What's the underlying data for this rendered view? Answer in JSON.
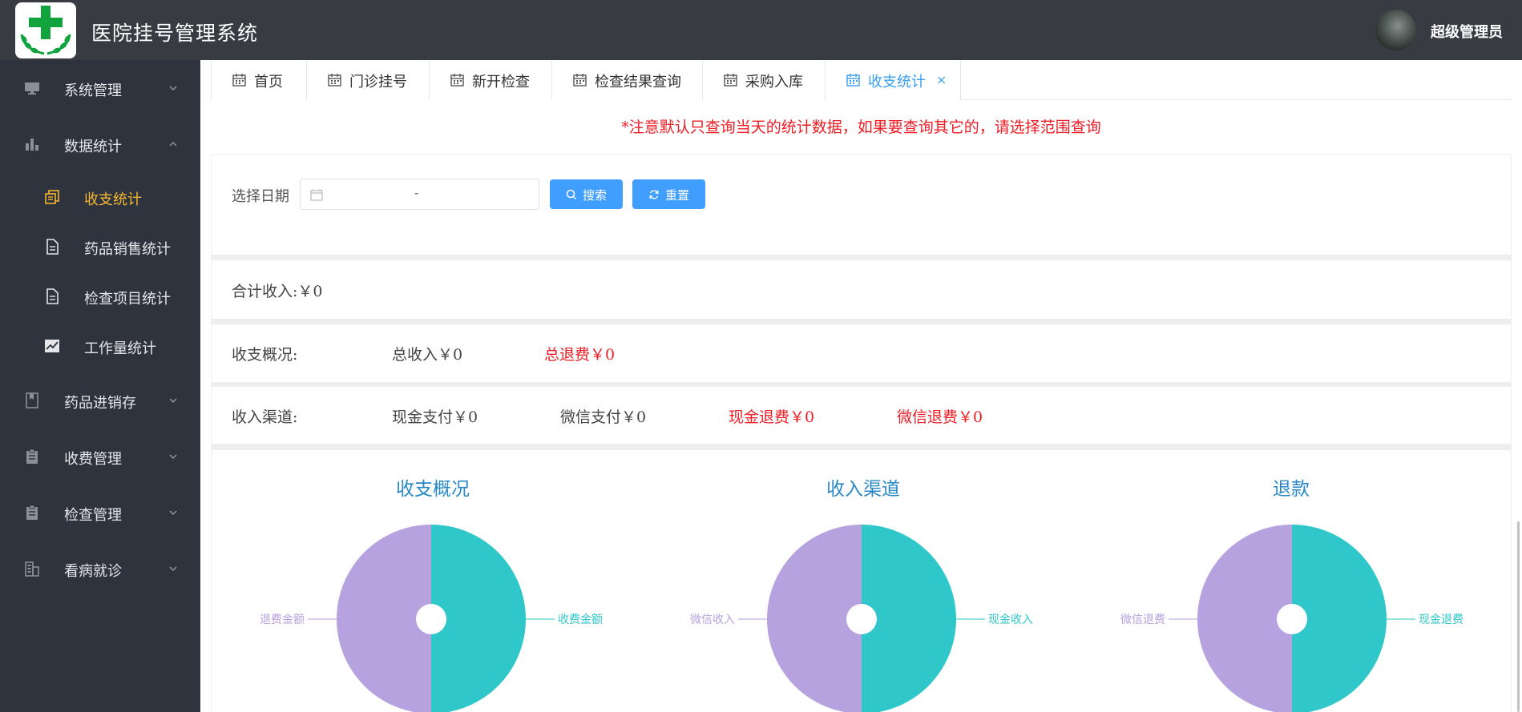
{
  "app": {
    "title": "医院挂号管理系统",
    "user": "超级管理员"
  },
  "colors": {
    "header_bg": "#383c42",
    "sidebar_bg": "#2f333e",
    "accent": "#409eff",
    "active_menu": "#f4b731",
    "warning": "#ee1d24",
    "pie_teal": "#2fc7c9",
    "pie_purple": "#b6a2de",
    "title_blue": "#2788c6"
  },
  "sidebar": {
    "items": [
      {
        "label": "系统管理",
        "icon": "monitor-icon",
        "expanded": false
      },
      {
        "label": "数据统计",
        "icon": "bar-chart-icon",
        "expanded": true
      },
      {
        "label": "药品进销存",
        "icon": "book-icon",
        "expanded": false
      },
      {
        "label": "收费管理",
        "icon": "clipboard-icon",
        "expanded": false
      },
      {
        "label": "检查管理",
        "icon": "clipboard-icon",
        "expanded": false
      },
      {
        "label": "看病就诊",
        "icon": "building-icon",
        "expanded": false
      }
    ],
    "sub_items": [
      {
        "label": "收支统计",
        "icon": "copy-icon",
        "active": true
      },
      {
        "label": "药品销售统计",
        "icon": "document-icon",
        "active": false
      },
      {
        "label": "检查项目统计",
        "icon": "document-icon",
        "active": false
      },
      {
        "label": "工作量统计",
        "icon": "trend-chart-icon",
        "active": false
      }
    ]
  },
  "tabs": [
    {
      "label": "首页",
      "icon": "calendar-icon"
    },
    {
      "label": "门诊挂号",
      "icon": "calendar-icon"
    },
    {
      "label": "新开检查",
      "icon": "calendar-icon"
    },
    {
      "label": "检查结果查询",
      "icon": "calendar-icon"
    },
    {
      "label": "采购入库",
      "icon": "calendar-icon"
    },
    {
      "label": "收支统计",
      "icon": "calendar-icon",
      "active": true,
      "close": "×"
    }
  ],
  "notice": "*注意默认只查询当天的统计数据，如果要查询其它的，请选择范围查询",
  "filter": {
    "date_label": "选择日期",
    "date_separator": "-",
    "search_label": "搜索",
    "reset_label": "重置"
  },
  "summary": {
    "total_income": "合计收入:￥0",
    "overview_label": "收支概况:",
    "overview_income": "总收入￥0",
    "overview_refund": "总退费￥0",
    "channel_label": "收入渠道:",
    "cash_pay": "现金支付￥0",
    "wechat_pay": "微信支付￥0",
    "cash_refund": "现金退费￥0",
    "wechat_refund": "微信退费￥0"
  },
  "chart_data": [
    {
      "type": "pie",
      "title": "收支概况",
      "labels": [
        "收费金额",
        "退费金额"
      ],
      "values": [
        1,
        1
      ],
      "colors": [
        "#2fc7c9",
        "#b6a2de"
      ]
    },
    {
      "type": "pie",
      "title": "收入渠道",
      "labels": [
        "现金收入",
        "微信收入"
      ],
      "values": [
        1,
        1
      ],
      "colors": [
        "#2fc7c9",
        "#b6a2de"
      ]
    },
    {
      "type": "pie",
      "title": "退款",
      "labels": [
        "现金退费",
        "微信退费"
      ],
      "values": [
        1,
        1
      ],
      "colors": [
        "#2fc7c9",
        "#b6a2de"
      ]
    }
  ]
}
